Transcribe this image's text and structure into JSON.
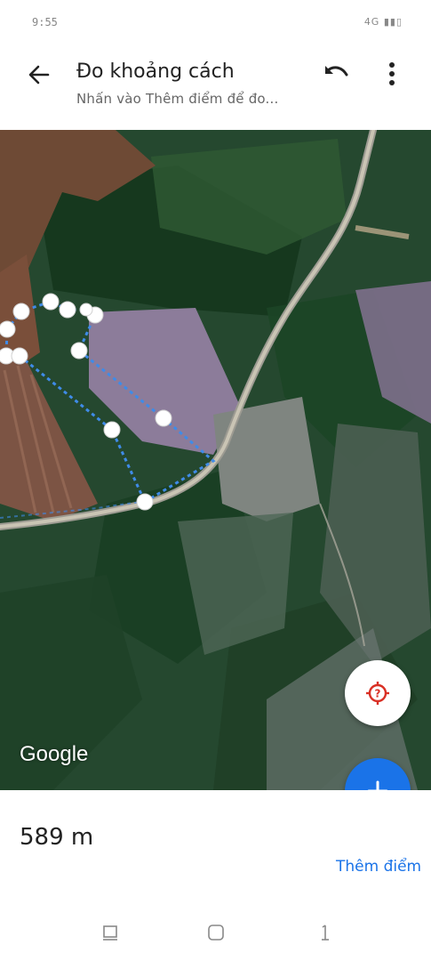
{
  "status_bar": {
    "time": "9:55",
    "icons": "4G ▮▮▯"
  },
  "header": {
    "title": "Đo khoảng cách",
    "subtitle": "Nhấn vào Thêm điểm để đo..."
  },
  "map": {
    "attribution": "Google"
  },
  "measurement": {
    "distance": "589 m",
    "add_point_label": "Thêm điểm"
  },
  "colors": {
    "accent": "#1a73e8",
    "measure_line": "#3f8be8",
    "location_icon": "#d93025"
  },
  "icons": [
    "back-arrow-icon",
    "undo-icon",
    "more-vert-icon",
    "location-help-icon",
    "plus-icon",
    "recent-apps-icon",
    "home-icon",
    "back-nav-icon"
  ]
}
